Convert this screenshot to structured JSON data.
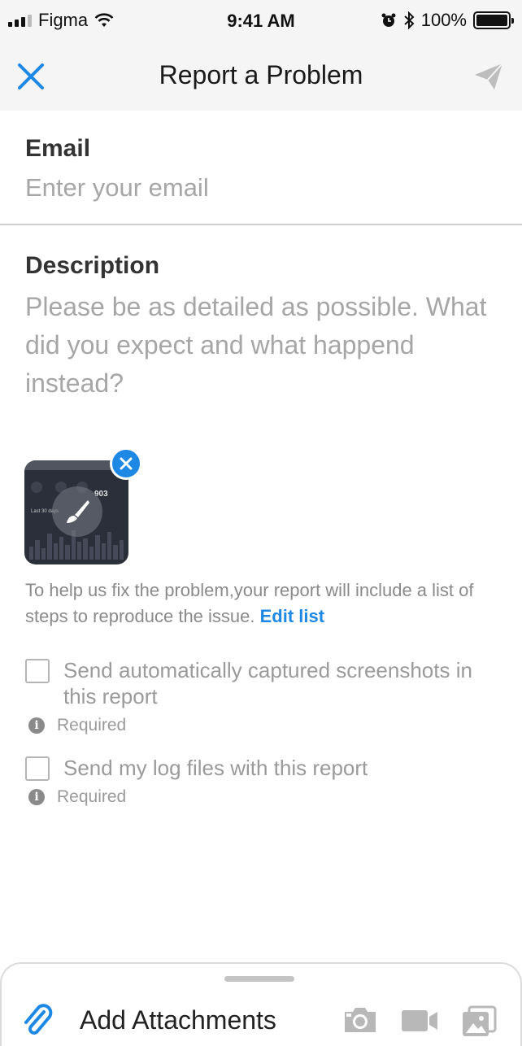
{
  "status_bar": {
    "carrier": "Figma",
    "time": "9:41 AM",
    "battery": "100%"
  },
  "nav": {
    "title": "Report a Problem",
    "close_icon": "close-icon",
    "send_icon": "send-icon"
  },
  "form": {
    "email": {
      "label": "Email",
      "placeholder": "Enter your email",
      "value": ""
    },
    "description": {
      "label": "Description",
      "placeholder": "Please be as detailed as possible. What did you expect and what happend instead?",
      "value": ""
    }
  },
  "attachment_preview": {
    "value_text": "903",
    "caption": "Last 30 days",
    "edit_icon": "brush-icon",
    "remove_icon": "close-icon"
  },
  "info": {
    "text": "To help us fix the problem,your report will include a list of steps to reproduce the issue.",
    "link": "Edit list"
  },
  "options": [
    {
      "label": "Send automatically captured screenshots in this report",
      "checked": false,
      "note": "Required"
    },
    {
      "label": "Send my log files with this report",
      "checked": false,
      "note": "Required"
    }
  ],
  "bottom_bar": {
    "attach_label": "Add Attachments",
    "icons": [
      "paperclip-icon",
      "camera-icon",
      "video-icon",
      "gallery-icon"
    ]
  },
  "colors": {
    "accent": "#1e88e5",
    "bar_background": "#f5f5f5"
  }
}
